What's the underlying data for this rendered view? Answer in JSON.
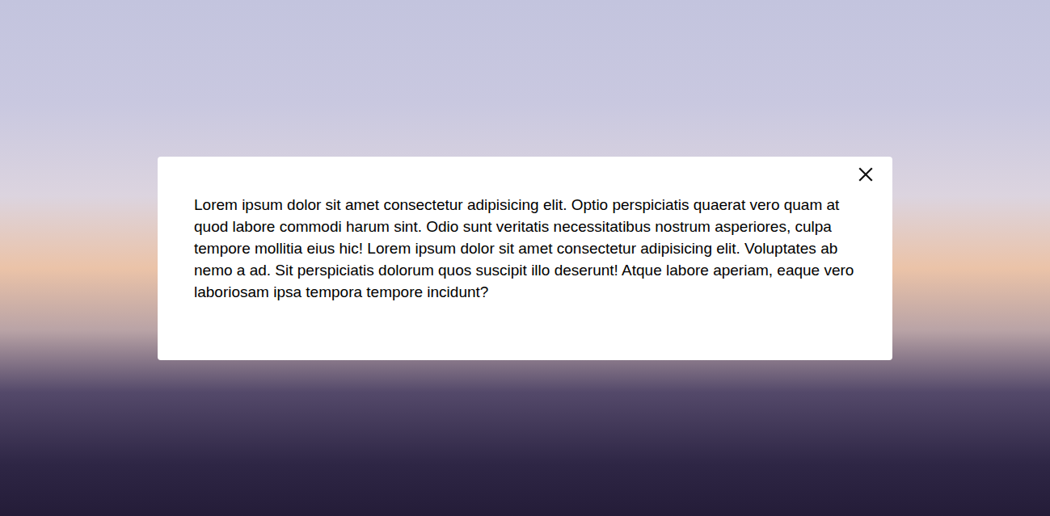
{
  "dialog": {
    "text": "Lorem ipsum dolor sit amet consectetur adipisicing elit. Optio perspiciatis quaerat vero quam at quod labore commodi harum sint. Odio sunt veritatis necessitatibus nostrum asperiores, culpa tempore mollitia eius hic! Lorem ipsum dolor sit amet consectetur adipisicing elit. Voluptates ab nemo a ad. Sit perspiciatis dolorum quos suscipit illo deserunt! Atque labore aperiam, eaque vero laboriosam ipsa tempora tempore incidunt?"
  }
}
